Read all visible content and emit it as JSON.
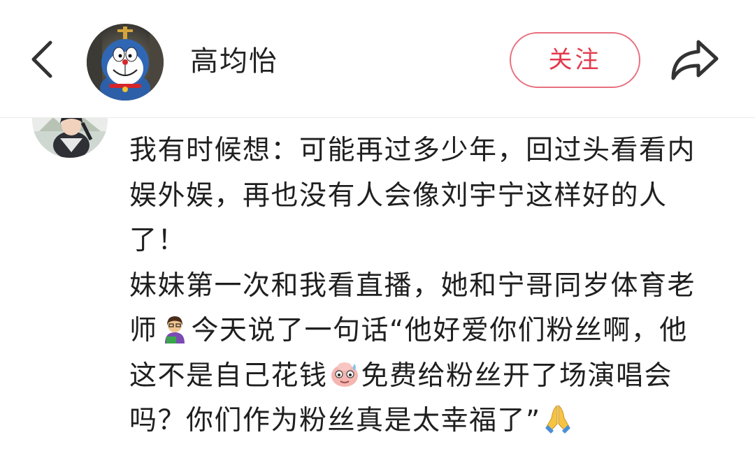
{
  "header": {
    "back_icon": "chevron-left-icon",
    "author_name": "高均怡",
    "follow_label": "关注",
    "share_icon": "share-arrow-icon",
    "follow_color": "#e23a4c"
  },
  "comment": {
    "lines": [
      "我有时候想：可能再过多少年，回过头看看内",
      "娱外娱，再也没有人会像刘宇宁这样好的人",
      "了！",
      "妹妹第一次和我看直播，她和宁哥同岁体育老",
      {
        "before": "师",
        "emoji": "teacher-emoji-icon",
        "after": "今天说了一句话“他好爱你们粉丝啊，他"
      },
      {
        "before": "这不是自己花钱",
        "emoji": "sweating-face-emoji-icon",
        "after": "免费给粉丝开了场演唱会"
      },
      {
        "before": "吗？你们作为粉丝真是太幸福了”",
        "emoji": "folded-hands-emoji-icon",
        "after": ""
      }
    ]
  }
}
